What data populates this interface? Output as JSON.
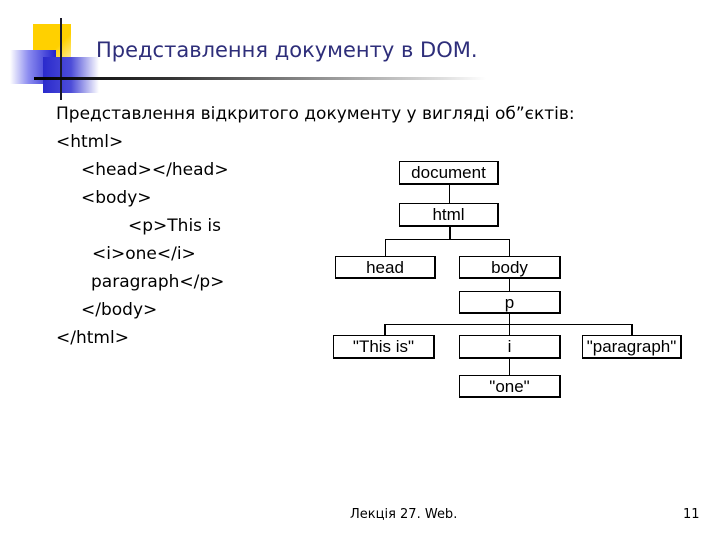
{
  "slide": {
    "title": "Представлення документу в DOM.",
    "intro": "Представлення відкритого документу у вигляді об”єктів:",
    "code_lines": [
      "<html>",
      "<head></head>",
      "<body>",
      "<p>This is",
      "<i>one</i>",
      "paragraph</p>",
      "</body>",
      "</html>"
    ],
    "tree": {
      "document": "document",
      "html": "html",
      "head": "head",
      "body": "body",
      "p": "p",
      "text_this_is": "\"This is\"",
      "i": "i",
      "text_paragraph": "\"paragraph\"",
      "text_one": "\"one\""
    },
    "footer": {
      "lecture": "Лекція 27. Web.",
      "page_number": "11"
    }
  }
}
